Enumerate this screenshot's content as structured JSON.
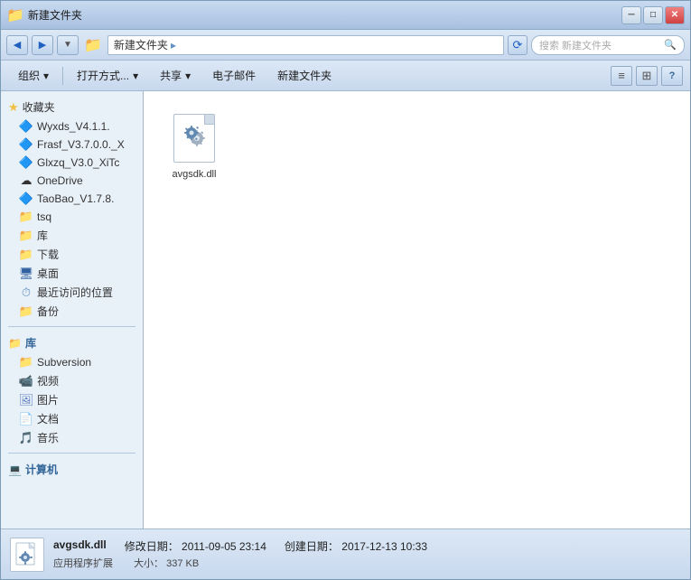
{
  "window": {
    "title": "新建文件夹",
    "controls": {
      "minimize": "─",
      "maximize": "□",
      "close": "✕"
    }
  },
  "addressBar": {
    "back": "◀",
    "forward": "▶",
    "folder_icon": "📁",
    "breadcrumb": "新建文件夹",
    "refresh": "⟳",
    "search_placeholder": "搜索 新建文件夹",
    "search_icon": "🔍"
  },
  "toolbar": {
    "organize": "组织",
    "organize_arrow": "▾",
    "open_mode": "打开方式...",
    "open_arrow": "▾",
    "share": "共享",
    "share_arrow": "▾",
    "email": "电子邮件",
    "new_folder": "新建文件夹",
    "help": "?"
  },
  "sidebar": {
    "favorites_label": "收藏夹",
    "items_favorites": [
      {
        "label": "Wyxds_V4.1.1.",
        "type": "app"
      },
      {
        "label": "Frasf_V3.7.0.0._X",
        "type": "app"
      },
      {
        "label": "Glxzq_V3.0_XiTc",
        "type": "app"
      },
      {
        "label": "OneDrive",
        "type": "cloud"
      },
      {
        "label": "TaoBao_V1.7.8.",
        "type": "app"
      },
      {
        "label": "tsq",
        "type": "folder"
      },
      {
        "label": "库",
        "type": "folder"
      },
      {
        "label": "下载",
        "type": "folder"
      },
      {
        "label": "桌面",
        "type": "folder"
      },
      {
        "label": "最近访问的位置",
        "type": "folder"
      },
      {
        "label": "备份",
        "type": "folder"
      }
    ],
    "library_label": "库",
    "items_library": [
      {
        "label": "Subversion",
        "type": "folder"
      },
      {
        "label": "视频",
        "type": "media"
      },
      {
        "label": "图片",
        "type": "media"
      },
      {
        "label": "文档",
        "type": "media"
      },
      {
        "label": "音乐",
        "type": "media"
      }
    ],
    "computer_label": "计算机"
  },
  "files": [
    {
      "name": "avgsdk.dll",
      "icon_type": "dll"
    }
  ],
  "statusBar": {
    "file_name": "avgsdk.dll",
    "modified_label": "修改日期：",
    "modified_value": "2011-09-05 23:14",
    "created_label": "创建日期：",
    "created_value": "2017-12-13 10:33",
    "type_label": "应用程序扩展",
    "size_label": "大小：",
    "size_value": "337 KB"
  }
}
